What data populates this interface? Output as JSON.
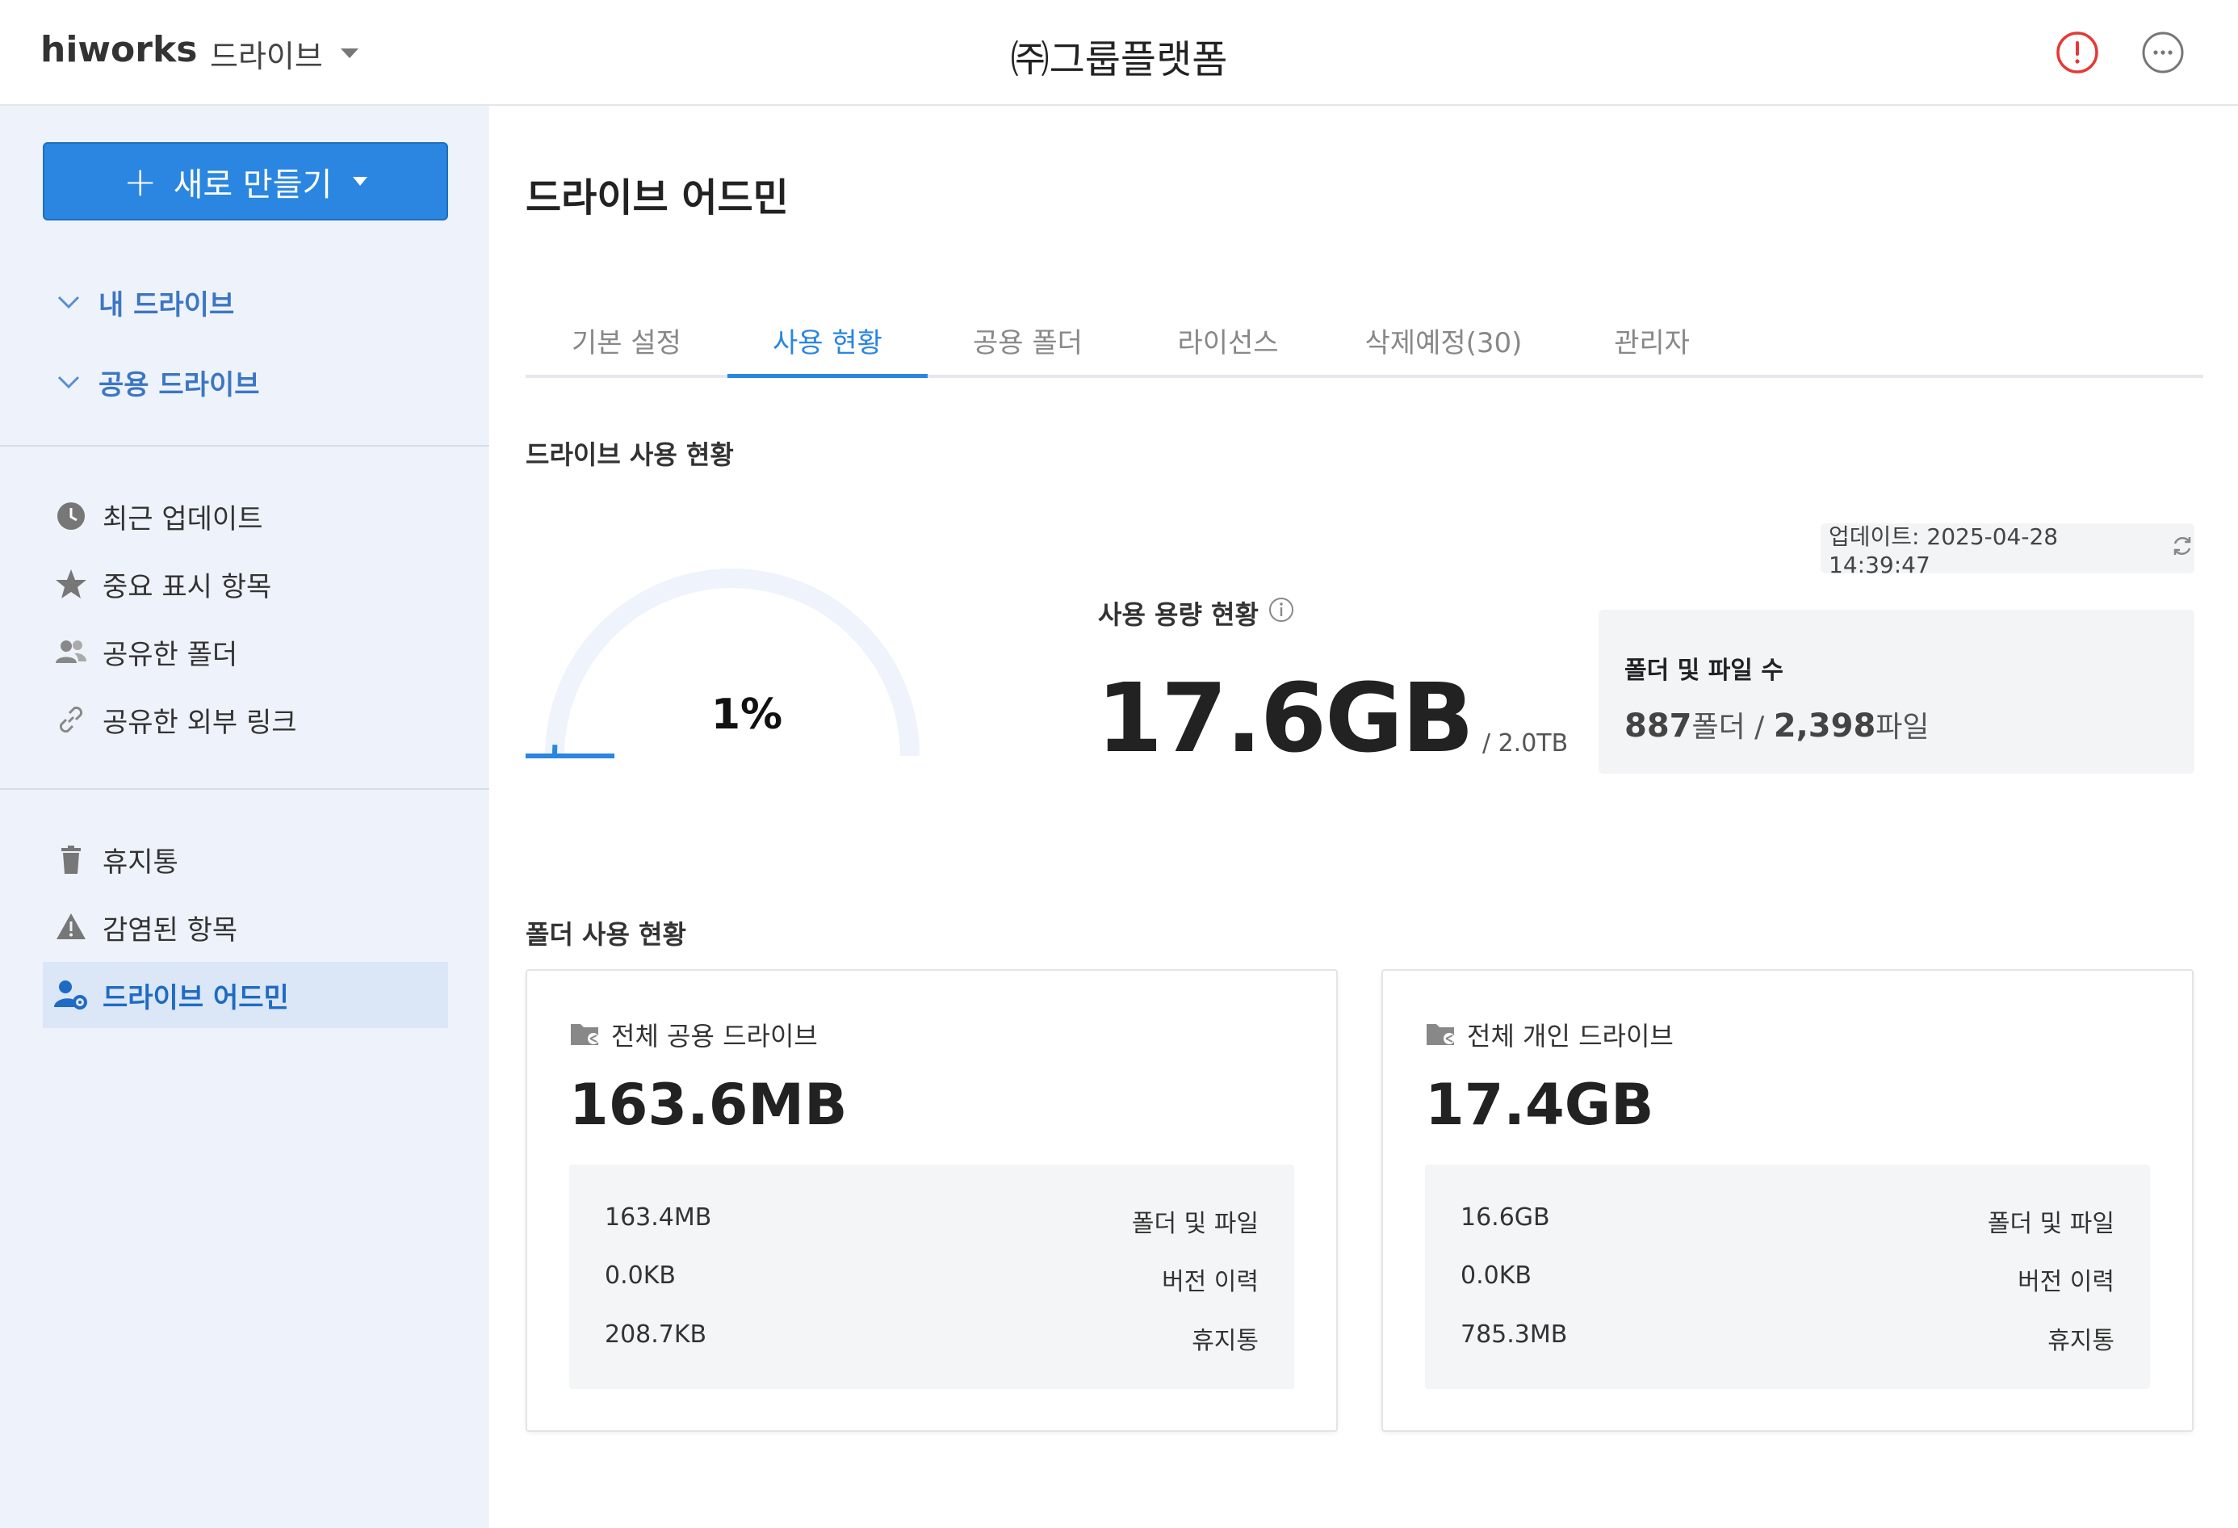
{
  "header": {
    "logo": "hiworks",
    "app_name": "드라이브",
    "company": "㈜그룹플랫폼",
    "icons": {
      "alert": "alert-icon",
      "more": "more-icon"
    },
    "alert_color": "#e53935"
  },
  "sidebar": {
    "new_button": {
      "plus": "+",
      "label": "새로 만들기"
    },
    "tree": [
      {
        "label": "내 드라이브",
        "icon": "chevron-down-icon"
      },
      {
        "label": "공용 드라이브",
        "icon": "chevron-down-icon"
      }
    ],
    "nav_group1": [
      {
        "label": "최근 업데이트",
        "icon": "clock-icon"
      },
      {
        "label": "중요 표시 항목",
        "icon": "star-icon"
      },
      {
        "label": "공유한 폴더",
        "icon": "users-icon"
      },
      {
        "label": "공유한 외부 링크",
        "icon": "link-icon"
      }
    ],
    "nav_group2": [
      {
        "label": "휴지통",
        "icon": "trash-icon"
      },
      {
        "label": "감염된 항목",
        "icon": "warning-icon"
      },
      {
        "label": "드라이브 어드민",
        "icon": "user-gear-icon",
        "active": true
      }
    ]
  },
  "main": {
    "title": "드라이브 어드민",
    "tabs": [
      {
        "label": "기본 설정"
      },
      {
        "label": "사용 현황",
        "active": true
      },
      {
        "label": "공용 폴더"
      },
      {
        "label": "라이선스"
      },
      {
        "label": "삭제예정(30)"
      },
      {
        "label": "관리자"
      }
    ],
    "usage_section": {
      "title": "드라이브 사용 현황",
      "update_text": "업데이트: 2025-04-28 14:39:47",
      "gauge_percent_label": "1%",
      "gauge_fraction": 0.01,
      "usage_label": "사용 용량 현황",
      "used": "17.6GB",
      "total": "/ 2.0TB",
      "count_title": "폴더 및 파일 수",
      "folders": "887",
      "folders_unit": "폴더 /",
      "files": "2,398",
      "files_unit": "파일"
    },
    "folder_section": {
      "title": "폴더 사용 현황",
      "cards": [
        {
          "title": "전체 공용 드라이브",
          "value": "163.6MB",
          "rows": [
            {
              "value": "163.4MB",
              "label": "폴더 및 파일"
            },
            {
              "value": "0.0KB",
              "label": "버전 이력"
            },
            {
              "value": "208.7KB",
              "label": "휴지통"
            }
          ]
        },
        {
          "title": "전체 개인 드라이브",
          "value": "17.4GB",
          "rows": [
            {
              "value": "16.6GB",
              "label": "폴더 및 파일"
            },
            {
              "value": "0.0KB",
              "label": "버전 이력"
            },
            {
              "value": "785.3MB",
              "label": "휴지통"
            }
          ]
        }
      ]
    }
  },
  "colors": {
    "accent": "#2a86e0",
    "sidebar_bg": "#eef3fb",
    "active_bg": "#dbe7f6"
  }
}
